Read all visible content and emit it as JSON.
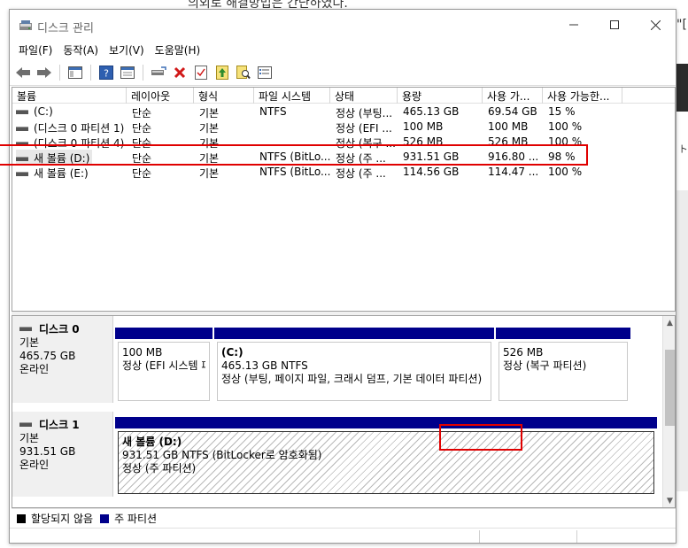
{
  "background": {
    "caption": "의외로 해결방법은 간단하였다.",
    "right_fragment": "\"[",
    "right_fragment2": "ト."
  },
  "window": {
    "title": "디스크 관리",
    "icon": "disk-management-icon"
  },
  "menu": [
    "파일(F)",
    "동작(A)",
    "보기(V)",
    "도움말(H)"
  ],
  "toolbar": [
    "back-icon",
    "forward-icon",
    "console-tree-icon",
    "help-icon",
    "properties-view-icon",
    "connect-drive-icon",
    "delete-icon",
    "check-icon",
    "import-icon",
    "search-icon",
    "details-icon"
  ],
  "volume_list": {
    "columns": [
      "볼륨",
      "레이아웃",
      "형식",
      "파일 시스템",
      "상태",
      "용량",
      "사용 가...",
      "사용 가능한..."
    ],
    "rows": [
      {
        "volume": "(C:)",
        "layout": "단순",
        "type": "기본",
        "fs": "NTFS",
        "status": "정상 (부팅...",
        "capacity": "465.13 GB",
        "free": "69.54 GB",
        "pct": "15 %"
      },
      {
        "volume": "(디스크 0 파티션 1)",
        "layout": "단순",
        "type": "기본",
        "fs": "",
        "status": "정상 (EFI ...",
        "capacity": "100 MB",
        "free": "100 MB",
        "pct": "100 %"
      },
      {
        "volume": "(디스크 0 파티션 4)",
        "layout": "단순",
        "type": "기본",
        "fs": "",
        "status": "정상 (복구 ...",
        "capacity": "526 MB",
        "free": "526 MB",
        "pct": "100 %"
      },
      {
        "volume": "새 볼륨 (D:)",
        "layout": "단순",
        "type": "기본",
        "fs": "NTFS (BitLo...",
        "status": "정상 (주 ...",
        "capacity": "931.51 GB",
        "free": "916.80 ...",
        "pct": "98 %"
      },
      {
        "volume": "새 볼륨 (E:)",
        "layout": "단순",
        "type": "기본",
        "fs": "NTFS (BitLo...",
        "status": "정상 (주 ...",
        "capacity": "114.56 GB",
        "free": "114.47 ...",
        "pct": "100 %"
      }
    ]
  },
  "disks": [
    {
      "name": "디스크 0",
      "type": "기본",
      "size": "465.75 GB",
      "status": "온라인",
      "partitions": [
        {
          "title": "",
          "line1": "100 MB",
          "line2": "정상 (EFI 시스템 파티션)"
        },
        {
          "title": "(C:)",
          "line1": "465.13 GB NTFS",
          "line2": "정상 (부팅, 페이지 파일, 크래시 덤프, 기본 데이터 파티션)"
        },
        {
          "title": "",
          "line1": "526 MB",
          "line2": "정상 (복구 파티션)"
        }
      ]
    },
    {
      "name": "디스크 1",
      "type": "기본",
      "size": "931.51 GB",
      "status": "온라인",
      "partitions": [
        {
          "title": "새 볼륨  (D:)",
          "line1": "931.51 GB NTFS (BitLocker로 암호화됨)",
          "line2": "정상 (주 파티션)"
        }
      ]
    }
  ],
  "legend": [
    {
      "label": "할당되지 않음",
      "color": "#000000"
    },
    {
      "label": "주 파티션",
      "color": "#00008b"
    }
  ]
}
